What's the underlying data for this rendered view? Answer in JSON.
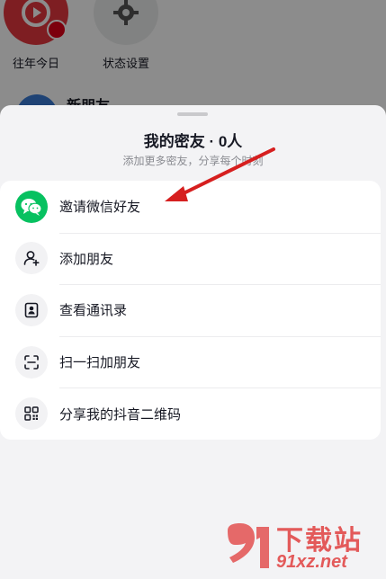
{
  "background": {
    "tiles": [
      {
        "label": "往年今日",
        "icon": "history-icon"
      },
      {
        "label": "状态设置",
        "icon": "gear-icon"
      }
    ],
    "friend_row": {
      "name": "新朋友"
    }
  },
  "sheet": {
    "title": "我的密友 · 0人",
    "subtitle": "添加更多密友，分享每个时刻",
    "items": [
      {
        "label": "邀请微信好友",
        "icon": "wechat-icon"
      },
      {
        "label": "添加朋友",
        "icon": "add-user-icon"
      },
      {
        "label": "查看通讯录",
        "icon": "contacts-icon"
      },
      {
        "label": "扫一扫加朋友",
        "icon": "scan-icon"
      },
      {
        "label": "分享我的抖音二维码",
        "icon": "qr-code-icon"
      }
    ]
  },
  "watermark": {
    "top_text": "下载站",
    "bottom_text": "91xz.net"
  },
  "colors": {
    "wechat_green": "#07c160",
    "annotation_arrow": "#d61f1f",
    "watermark": "#e35a5a"
  }
}
